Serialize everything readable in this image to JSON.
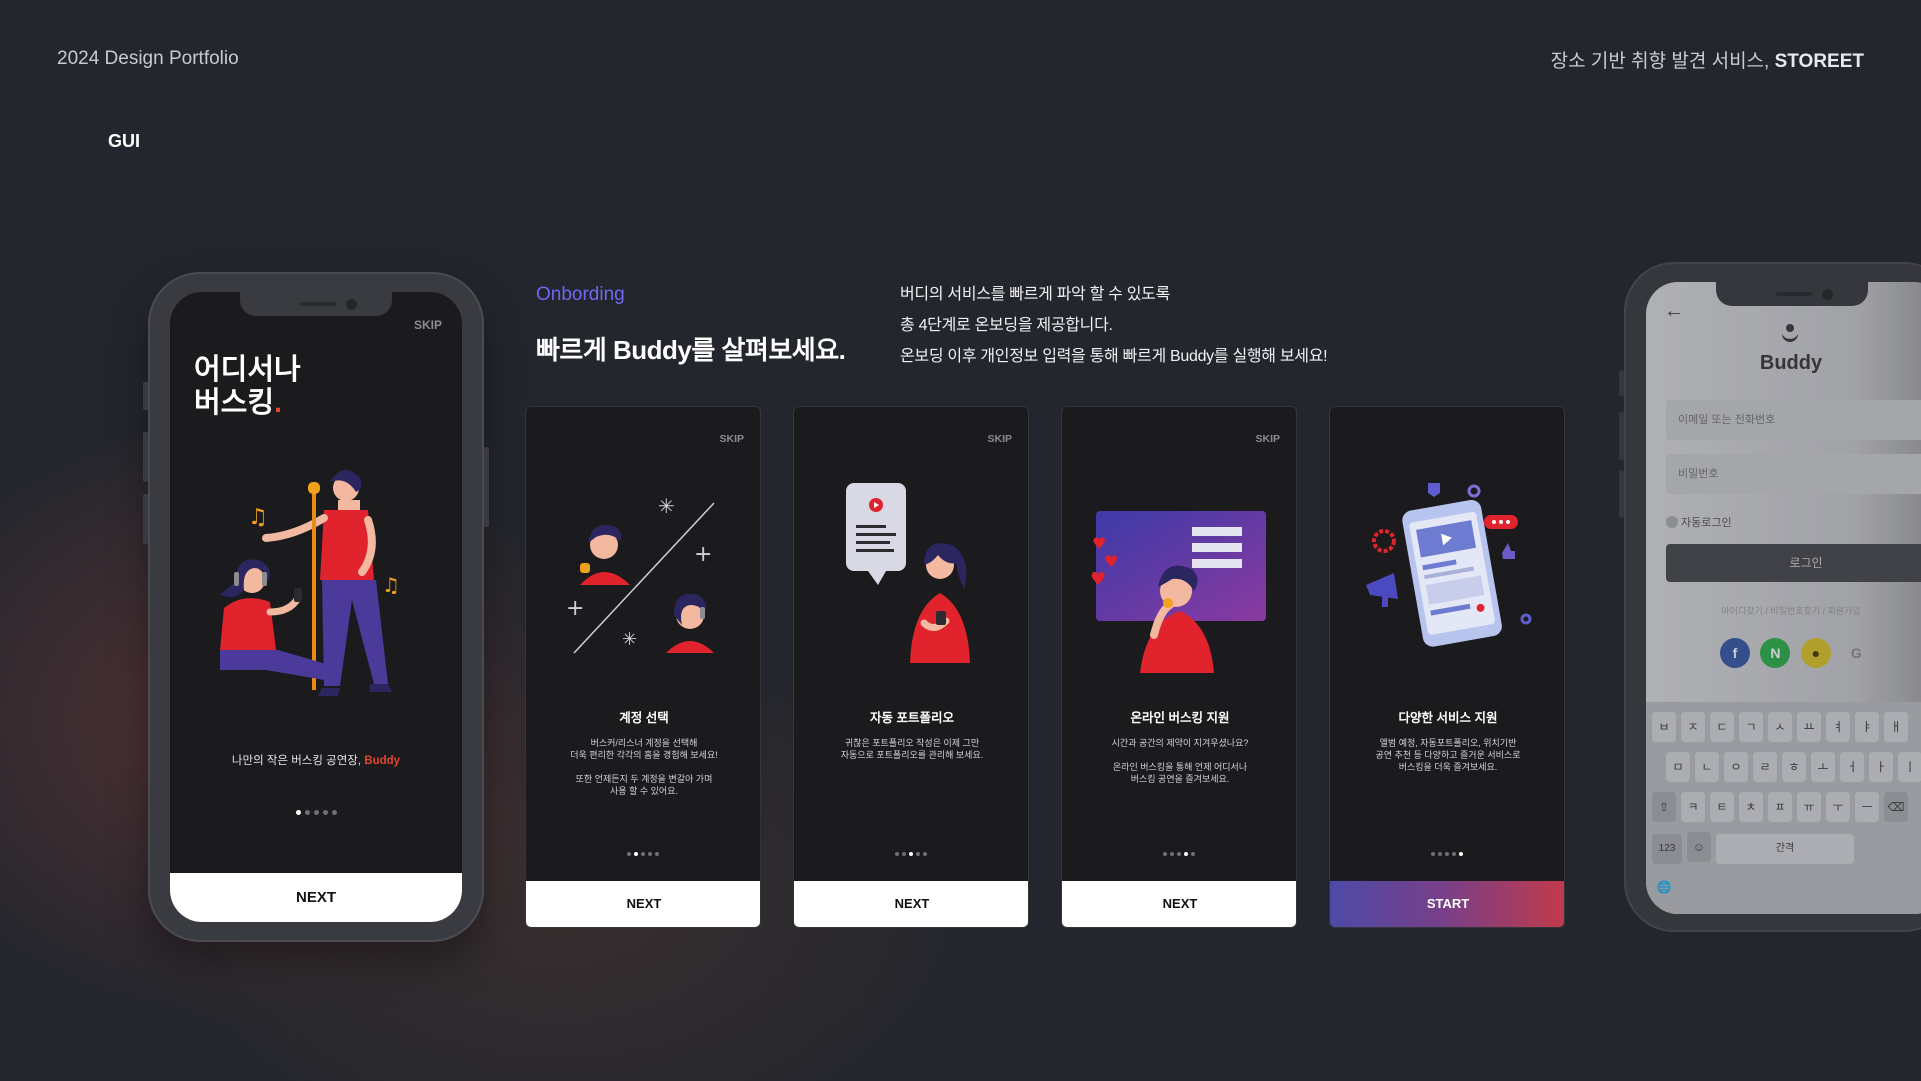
{
  "header": {
    "left": "2024 Design Portfolio",
    "right_prefix": "장소 기반 취향 발견 서비스, ",
    "right_brand": "STOREET"
  },
  "section_label": "GUI",
  "main_phone": {
    "skip": "SKIP",
    "title_line1": "어디서나",
    "title_line2": "버스킹",
    "title_dot": ".",
    "caption_prefix": "나만의 작은 버스킹 공연장, ",
    "caption_brand": "Buddy",
    "next": "NEXT",
    "page_index": 1,
    "page_count": 5
  },
  "onboarding": {
    "label": "Onbording",
    "title": "빠르게 Buddy를 살펴보세요.",
    "description": [
      "버디의 서비스를 빠르게 파악 할 수 있도록",
      "총 4단계로 온보딩을 제공합니다.",
      "온보딩 이후 개인정보 입력을 통해 빠르게 Buddy를 실행해 보세요!"
    ]
  },
  "cards": [
    {
      "skip": "SKIP",
      "title": "계정 선택",
      "desc": "버스커/리스너 계정을 선택해\n더욱 편리한 각각의 홈을 경험해 보세요!\n\n또한 언제든지 두 계정을 변갈아 가며\n사용 할 수 있어요.",
      "button": "NEXT",
      "active_dot": 2,
      "illustration": "account-select-illustration"
    },
    {
      "skip": "SKIP",
      "title": "자동 포트폴리오",
      "desc": "귀찮은 포트폴리오 작성은 이제 그만\n자동으로 포트폴리오를 관리해 보세요.",
      "button": "NEXT",
      "active_dot": 3,
      "illustration": "auto-portfolio-illustration"
    },
    {
      "skip": "SKIP",
      "title": "온라인 버스킹 지원",
      "desc": "시간과 공간의 제약이 지겨우셨나요?\n\n온라인 버스킹을 통해 언제 어디서나\n버스킹 공연을 즐겨보세요.",
      "button": "NEXT",
      "active_dot": 4,
      "illustration": "online-busking-illustration"
    },
    {
      "skip": "",
      "title": "다양한 서비스 지원",
      "desc": "앨범 예정, 자동포트폴리오, 위치기반\n공연 추천 등 다양하고 즐거운 서비스로\n버스킹을 더욱 즐겨보세요.",
      "button": "START",
      "active_dot": 5,
      "illustration": "various-services-illustration"
    }
  ],
  "login_phone": {
    "back": "←",
    "logo": "Buddy",
    "email_placeholder": "이메일 또는 전화번호",
    "password_placeholder": "비밀번호",
    "auto_login": "자동로그인",
    "login_button": "로그인",
    "links": "아이디찾기 / 비밀번호찾기 / 회원가입",
    "social": [
      "f",
      "N",
      "●",
      "G"
    ],
    "keyboard": {
      "row1": [
        "ㅂ",
        "ㅈ",
        "ㄷ",
        "ㄱ",
        "ㅅ",
        "ㅛ",
        "ㅕ",
        "ㅑ",
        "ㅐ"
      ],
      "row2": [
        "ㅁ",
        "ㄴ",
        "ㅇ",
        "ㄹ",
        "ㅎ",
        "ㅗ",
        "ㅓ",
        "ㅏ",
        "ㅣ"
      ],
      "row3": [
        "⇧",
        "ㅋ",
        "ㅌ",
        "ㅊ",
        "ㅍ",
        "ㅠ",
        "ㅜ",
        "ㅡ",
        "⌫"
      ],
      "num_key": "123",
      "emoji_key": "☺",
      "space_key": "간격",
      "globe_key": "🌐"
    }
  },
  "colors": {
    "background": "#24262d",
    "accent_purple": "#7068f0",
    "accent_red": "#e2462e",
    "start_gradient_start": "#4d4aa8",
    "start_gradient_end": "#c23a4a"
  }
}
